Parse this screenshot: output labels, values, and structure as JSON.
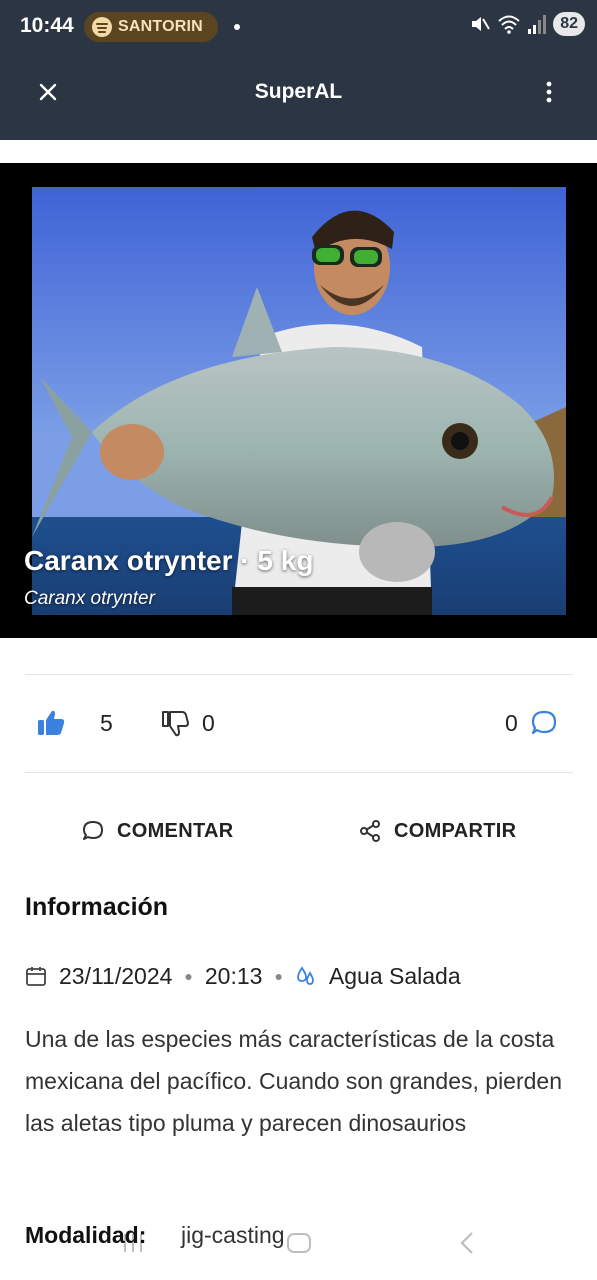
{
  "status_bar": {
    "time": "10:44",
    "media_app_icon": "spotify-icon",
    "media_title": "SANTORIN",
    "battery": "82"
  },
  "app_bar": {
    "title": "SuperAL",
    "close_icon": "close-icon",
    "menu_icon": "more-vert-icon"
  },
  "post": {
    "photo_title": "Caranx otrynter · 5 kg",
    "photo_subtitle": "Caranx otrynter",
    "likes": "5",
    "dislikes": "0",
    "comments": "0",
    "comment_action": "COMENTAR",
    "share_action": "COMPARTIR",
    "like_active_color": "#3b82e0"
  },
  "info": {
    "heading": "Información",
    "date": "23/11/2024",
    "time": "20:13",
    "water_type": "Agua Salada",
    "description": "Una de las especies más características de la costa mexicana del pacífico. Cuando son grandes, pierden las aletas tipo pluma y parecen dinosaurios",
    "modality_label": "Modalidad:",
    "modality_value": "jig-casting"
  },
  "colors": {
    "app_bar": "#2c3544",
    "accent": "#3b82e0"
  }
}
